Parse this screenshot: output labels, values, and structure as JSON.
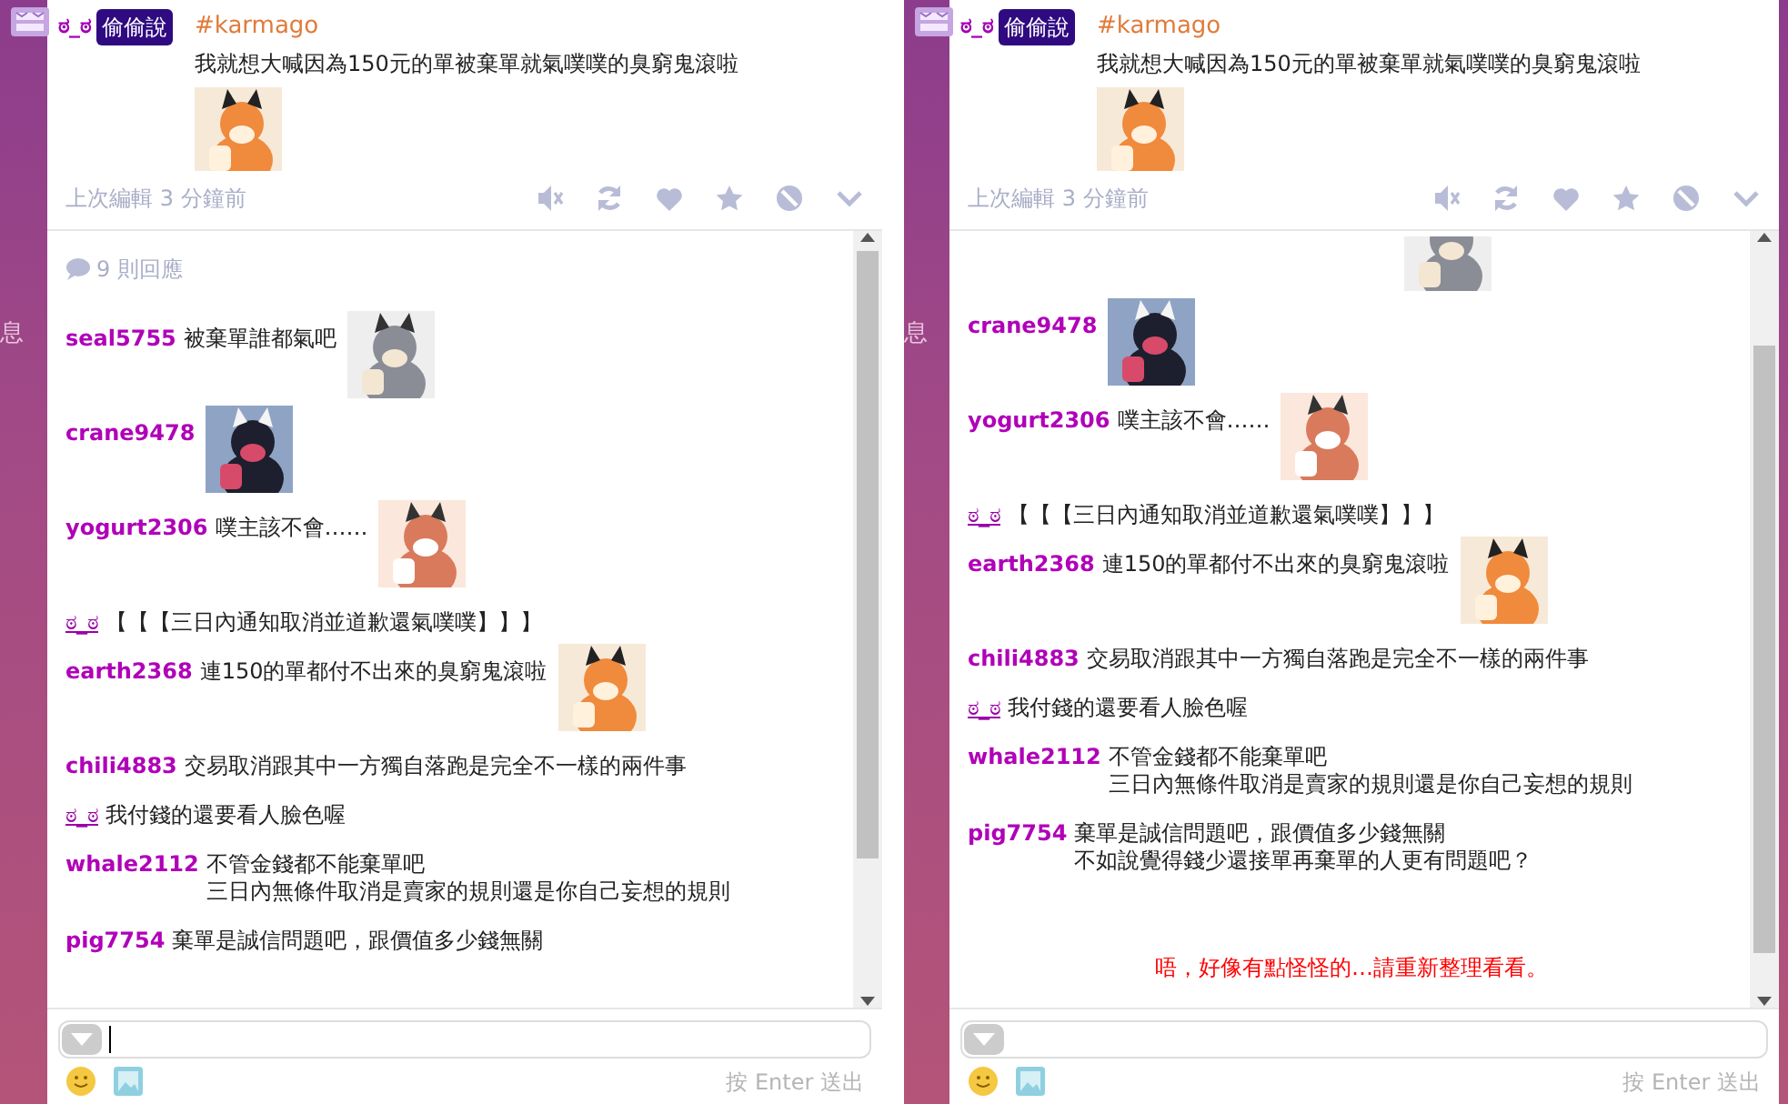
{
  "panels": [
    {
      "side_label": "息",
      "plurk": {
        "user": "ಠ_ಠ",
        "qualifier": "偷偷說",
        "tag": "#karmago",
        "content": "我就想大喊因為150元的單被棄單就氣噗噗的臭窮鬼滾啦",
        "sticker": true,
        "meta": "上次編輯 3 分鐘前"
      },
      "response_count": "9 則回應",
      "responses": [
        {
          "kind": "member",
          "user": "seal5755",
          "lines": [
            "被棄單誰都氣吧"
          ],
          "sticker": true
        },
        {
          "kind": "member",
          "user": "crane9478",
          "sticker": true
        },
        {
          "kind": "member",
          "user": "yogurt2306",
          "lines": [
            "噗主該不會……"
          ],
          "sticker": true
        },
        {
          "kind": "owner",
          "user": "ಠ_ಠ",
          "lines": [
            "【【【三日內通知取消並道歉還氣噗噗】】】"
          ],
          "sticker": false
        },
        {
          "kind": "member",
          "user": "earth2368",
          "lines": [
            "連150的單都付不出來的臭窮鬼滾啦"
          ],
          "sticker": true
        },
        {
          "kind": "member",
          "user": "chili4883",
          "lines": [
            "交易取消跟其中一方獨自落跑是完全不一樣的兩件事"
          ],
          "sticker": false
        },
        {
          "kind": "owner",
          "user": "ಠ_ಠ",
          "lines": [
            "我付錢的還要看人臉色喔"
          ],
          "sticker": false
        },
        {
          "kind": "member",
          "user": "whale2112",
          "lines": [
            "不管金錢都不能棄單吧",
            "三日內無條件取消是賣家的規則還是你自己妄想的規則"
          ],
          "sticker": false
        },
        {
          "kind": "member",
          "user": "pig7754",
          "lines": [
            "棄單是誠信問題吧，跟價值多少錢無關"
          ],
          "sticker": false
        }
      ],
      "input": {
        "focused": true
      },
      "hint": "按 Enter 送出"
    },
    {
      "side_label": "息",
      "plurk": {
        "user": "ಠ_ಠ",
        "qualifier": "偷偷說",
        "tag": "#karmago",
        "content": "我就想大喊因為150元的單被棄單就氣噗噗的臭窮鬼滾啦",
        "sticker": true,
        "meta": "上次編輯 3 分鐘前"
      },
      "responses": [
        {
          "kind": "fragment",
          "sticker": true
        },
        {
          "kind": "member",
          "user": "crane9478",
          "sticker": true
        },
        {
          "kind": "member",
          "user": "yogurt2306",
          "lines": [
            "噗主該不會……"
          ],
          "sticker": true
        },
        {
          "kind": "owner",
          "user": "ಠ_ಠ",
          "lines": [
            "【【【三日內通知取消並道歉還氣噗噗】】】"
          ],
          "sticker": false
        },
        {
          "kind": "member",
          "user": "earth2368",
          "lines": [
            "連150的單都付不出來的臭窮鬼滾啦"
          ],
          "sticker": true
        },
        {
          "kind": "member",
          "user": "chili4883",
          "lines": [
            "交易取消跟其中一方獨自落跑是完全不一樣的兩件事"
          ],
          "sticker": false
        },
        {
          "kind": "owner",
          "user": "ಠ_ಠ",
          "lines": [
            "我付錢的還要看人臉色喔"
          ],
          "sticker": false
        },
        {
          "kind": "member",
          "user": "whale2112",
          "lines": [
            "不管金錢都不能棄單吧",
            "三日內無條件取消是賣家的規則還是你自己妄想的規則"
          ],
          "sticker": false
        },
        {
          "kind": "member",
          "user": "pig7754",
          "lines": [
            "棄單是誠信問題吧，跟價值多少錢無關",
            "不如說覺得錢少還接單再棄單的人更有問題吧？"
          ],
          "sticker": false
        }
      ],
      "error": "唔，好像有點怪怪的…請重新整理看看。",
      "input": {
        "focused": false
      },
      "hint": "按 Enter 送出"
    }
  ]
}
